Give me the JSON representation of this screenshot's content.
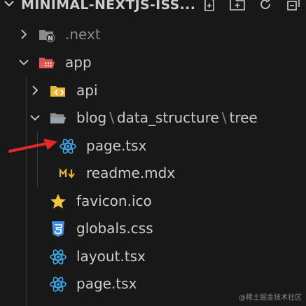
{
  "explorer": {
    "title": "MINIMAL-NEXTJS-ISS...",
    "actions": [
      {
        "icon": "new-file-icon"
      },
      {
        "icon": "new-folder-icon"
      },
      {
        "icon": "refresh-icon"
      },
      {
        "icon": "collapse-all-icon"
      }
    ]
  },
  "tree": {
    "next": ".next",
    "app": "app",
    "api": "api",
    "blog_path": [
      "blog",
      "data_structure",
      "tree"
    ],
    "nested_page": "page.tsx",
    "readme": "readme.mdx",
    "favicon": "favicon.ico",
    "globals": "globals.css",
    "layout": "layout.tsx",
    "page": "page.tsx"
  },
  "colors": {
    "background": "#181818",
    "text": "#cccccc",
    "dim_text": "#8b8b8b",
    "arrow": "#e02a2a",
    "react": "#3fa9e8",
    "css": "#3f8fe0",
    "star": "#f3c53f",
    "mdx": "#f0b429"
  },
  "watermark": "@稀土掘金技术社区"
}
